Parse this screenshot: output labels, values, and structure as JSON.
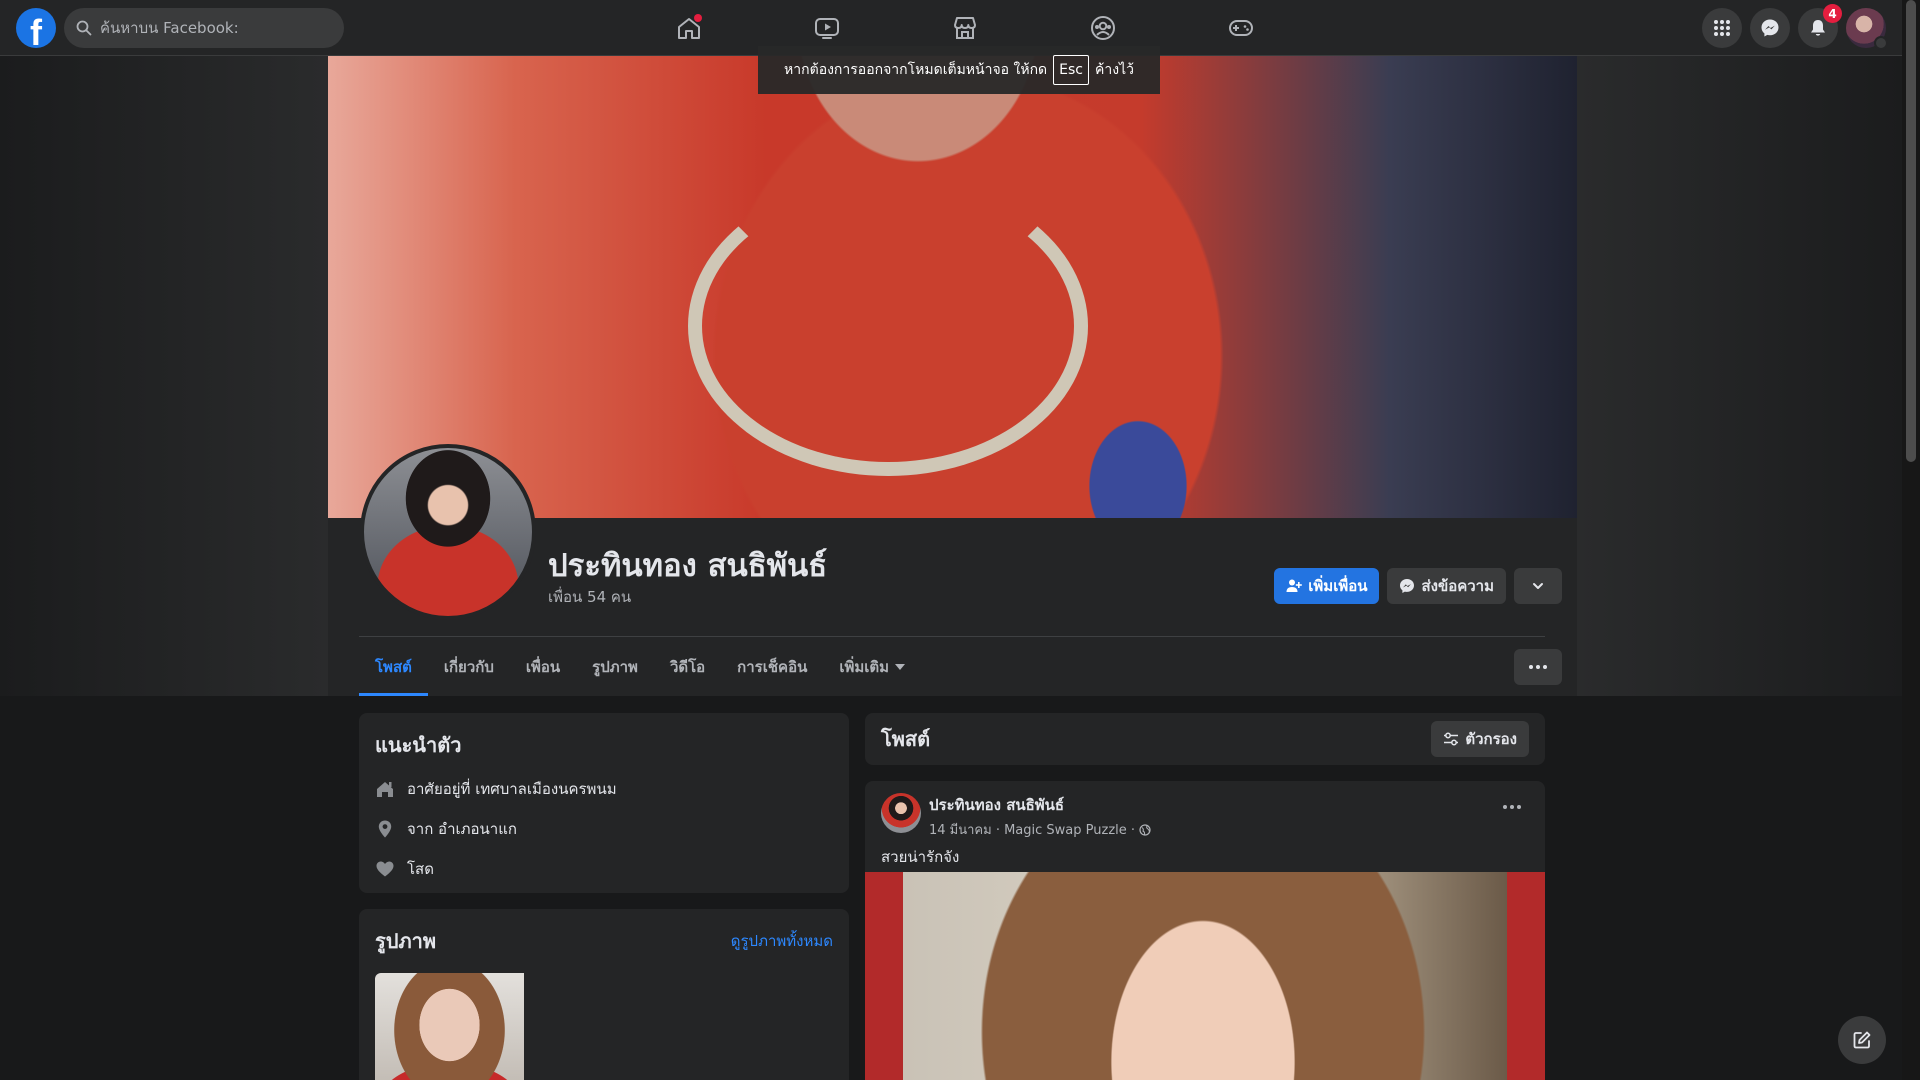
{
  "topnav": {
    "logo": "f",
    "search_placeholder": "ค้นหาบน Facebook:",
    "notifications_count": "4"
  },
  "fullscreen_notice": {
    "before": "หากต้องการออกจากโหมดเต็มหน้าจอ ให้กด",
    "key": "Esc",
    "after": "ค้างไว้"
  },
  "profile": {
    "name": "ประทินทอง สนธิพันธ์",
    "friends": "เพื่อน 54 คน",
    "add_friend": "เพิ่มเพื่อน",
    "message": "ส่งข้อความ"
  },
  "tabs": [
    {
      "label": "โพสต์"
    },
    {
      "label": "เกี่ยวกับ"
    },
    {
      "label": "เพื่อน"
    },
    {
      "label": "รูปภาพ"
    },
    {
      "label": "วิดีโอ"
    },
    {
      "label": "การเช็คอิน"
    },
    {
      "label": "เพิ่มเติม"
    }
  ],
  "intro": {
    "title": "แนะนำตัว",
    "lives": "อาศัยอยู่ที่ เทศบาลเมืองนครพนม",
    "from": "จาก อำเภอนาแก",
    "relationship": "โสด"
  },
  "photos": {
    "title": "รูปภาพ",
    "see_all": "ดูรูปภาพทั้งหมด"
  },
  "posts": {
    "title": "โพสต์",
    "filter": "ตัวกรอง"
  },
  "post": {
    "author": "ประทินทอง สนธิพันธ์",
    "date_app": "14 มีนาคม · Magic Swap Puzzle ·",
    "text": "สวยน่ารักจัง"
  },
  "colors": {
    "accent": "#2374e1",
    "link": "#2d88ff",
    "badge": "#e41e3f"
  }
}
